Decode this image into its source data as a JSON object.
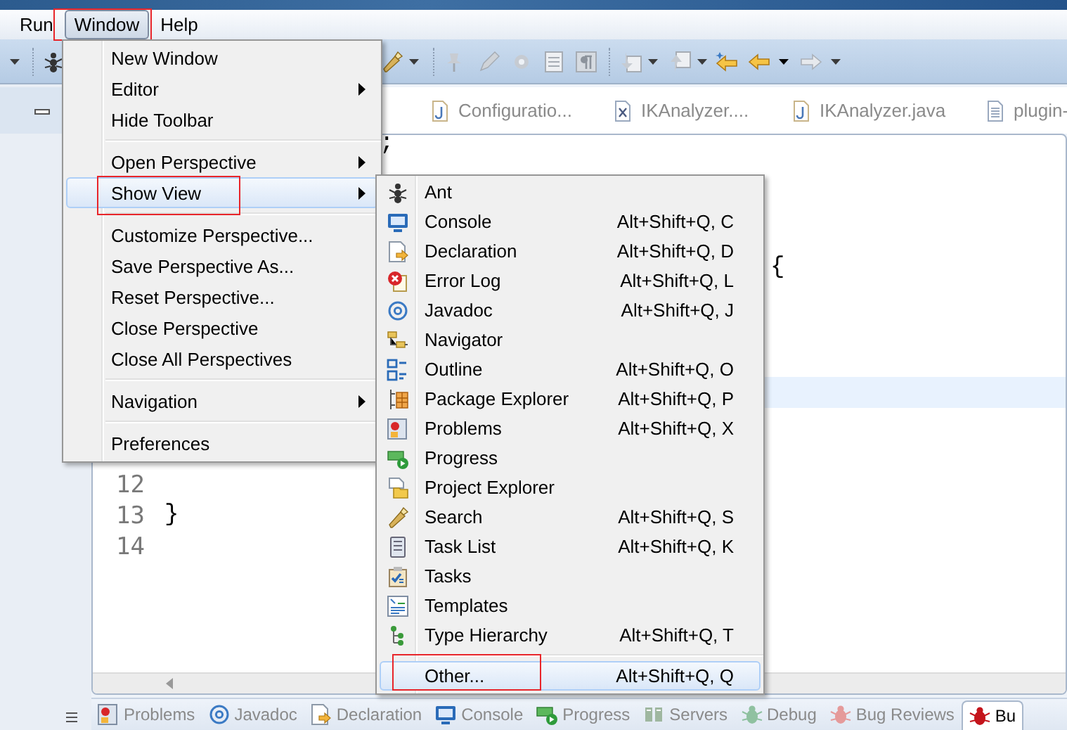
{
  "menu_bar": [
    {
      "label": "Run",
      "selected": false,
      "annotated": false
    },
    {
      "label": "Window",
      "selected": true,
      "annotated": true
    },
    {
      "label": "Help",
      "selected": false,
      "annotated": false
    }
  ],
  "editor_tabs": [
    {
      "label": "Configuratio..."
    },
    {
      "label": "IKAnalyzer...."
    },
    {
      "label": "IKAnalyzer.java"
    },
    {
      "label": "plugin-"
    }
  ],
  "editor": {
    "lines": [
      {
        "text": ";",
        "current": false
      },
      {
        "current": false
      },
      {
        "current": false
      },
      {
        "current": false
      },
      {
        "text": "{",
        "current": false
      },
      {
        "current": false
      },
      {
        "current": false
      },
      {
        "current": false
      },
      {
        "current": true
      },
      {
        "current": false
      },
      {
        "current": false
      },
      {
        "number": "12",
        "current": false
      },
      {
        "number": "13",
        "text": "}",
        "current": false
      },
      {
        "number": "14",
        "current": false
      }
    ]
  },
  "bottom_tabs": [
    {
      "label": "Problems",
      "selected": false
    },
    {
      "label": "Javadoc",
      "selected": false
    },
    {
      "label": "Declaration",
      "selected": false
    },
    {
      "label": "Console",
      "selected": false
    },
    {
      "label": "Progress",
      "selected": false
    },
    {
      "label": "Servers",
      "selected": false
    },
    {
      "label": "Debug",
      "selected": false
    },
    {
      "label": "Bug Reviews",
      "selected": false
    },
    {
      "label": "Bu",
      "selected": true
    }
  ],
  "window_menu": {
    "groups": [
      [
        {
          "label": "New Window",
          "submenu": false,
          "selected": false,
          "annotated": false
        },
        {
          "label": "Editor",
          "submenu": true,
          "selected": false,
          "annotated": false
        },
        {
          "label": "Hide Toolbar",
          "submenu": false,
          "selected": false,
          "annotated": false
        }
      ],
      [
        {
          "label": "Open Perspective",
          "submenu": true,
          "selected": false,
          "annotated": false
        },
        {
          "label": "Show View",
          "submenu": true,
          "selected": true,
          "annotated": true
        }
      ],
      [
        {
          "label": "Customize Perspective...",
          "submenu": false,
          "selected": false,
          "annotated": false
        },
        {
          "label": "Save Perspective As...",
          "submenu": false,
          "selected": false,
          "annotated": false
        },
        {
          "label": "Reset Perspective...",
          "submenu": false,
          "selected": false,
          "annotated": false
        },
        {
          "label": "Close Perspective",
          "submenu": false,
          "selected": false,
          "annotated": false
        },
        {
          "label": "Close All Perspectives",
          "submenu": false,
          "selected": false,
          "annotated": false
        }
      ],
      [
        {
          "label": "Navigation",
          "submenu": true,
          "selected": false,
          "annotated": false
        }
      ],
      [
        {
          "label": "Preferences",
          "submenu": false,
          "selected": false,
          "annotated": false
        }
      ]
    ]
  },
  "show_view_menu": {
    "groups": [
      [
        {
          "label": "Ant",
          "selected": false,
          "annotated": false
        },
        {
          "label": "Console",
          "shortcut": "Alt+Shift+Q, C",
          "selected": false,
          "annotated": false
        },
        {
          "label": "Declaration",
          "shortcut": "Alt+Shift+Q, D",
          "selected": false,
          "annotated": false
        },
        {
          "label": "Error Log",
          "shortcut": "Alt+Shift+Q, L",
          "selected": false,
          "annotated": false
        },
        {
          "label": "Javadoc",
          "shortcut": "Alt+Shift+Q, J",
          "selected": false,
          "annotated": false
        },
        {
          "label": "Navigator",
          "selected": false,
          "annotated": false
        },
        {
          "label": "Outline",
          "shortcut": "Alt+Shift+Q, O",
          "selected": false,
          "annotated": false
        },
        {
          "label": "Package Explorer",
          "shortcut": "Alt+Shift+Q, P",
          "selected": false,
          "annotated": false
        },
        {
          "label": "Problems",
          "shortcut": "Alt+Shift+Q, X",
          "selected": false,
          "annotated": false
        },
        {
          "label": "Progress",
          "selected": false,
          "annotated": false
        },
        {
          "label": "Project Explorer",
          "selected": false,
          "annotated": false
        },
        {
          "label": "Search",
          "shortcut": "Alt+Shift+Q, S",
          "selected": false,
          "annotated": false
        },
        {
          "label": "Task List",
          "shortcut": "Alt+Shift+Q, K",
          "selected": false,
          "annotated": false
        },
        {
          "label": "Tasks",
          "selected": false,
          "annotated": false
        },
        {
          "label": "Templates",
          "selected": false,
          "annotated": false
        },
        {
          "label": "Type Hierarchy",
          "shortcut": "Alt+Shift+Q, T",
          "selected": false,
          "annotated": false
        }
      ],
      [
        {
          "label": "Other...",
          "shortcut": "Alt+Shift+Q, Q",
          "selected": true,
          "annotated": true
        }
      ]
    ]
  }
}
